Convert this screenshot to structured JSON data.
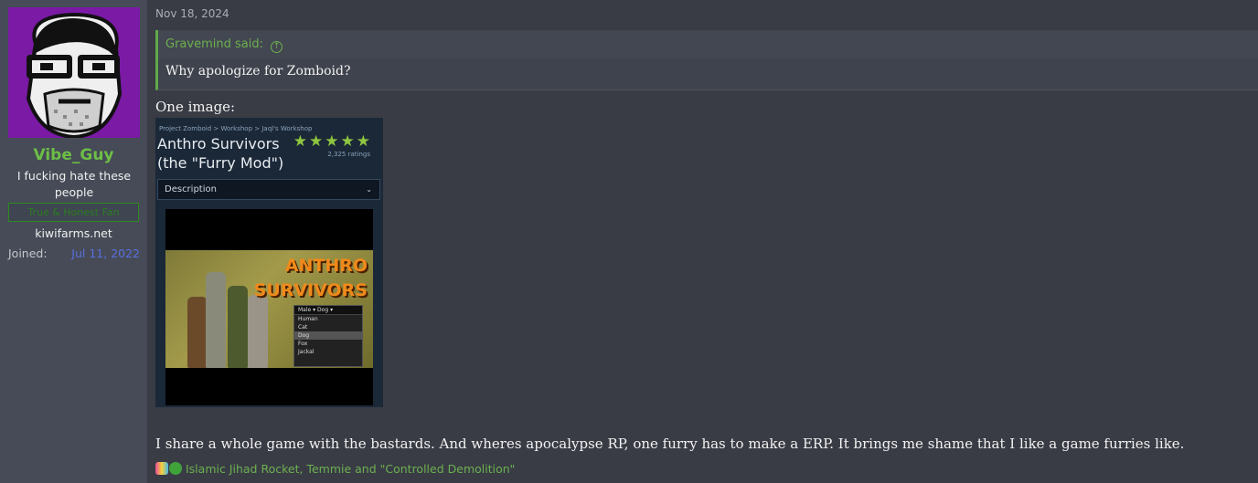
{
  "post": {
    "date": "Nov 18, 2024"
  },
  "author": {
    "username": "Vibe_Guy",
    "title": "I fucking hate these people",
    "banner": "True & Honest Fan",
    "site": "kiwifarms.net",
    "joined_label": "Joined:",
    "joined_value": "Jul 11, 2022"
  },
  "quote": {
    "author": "Gravemind said:",
    "text": "Why apologize for Zomboid?"
  },
  "body": {
    "line1": "One image:",
    "line2": "I share a whole game with the bastards. And wheres apocalypse RP, one furry has to make a ERP. It brings me shame that I like a game furries like."
  },
  "embed": {
    "breadcrumb": "Project Zomboid  >  Workshop  >  Jaql's Workshop",
    "title": "Anthro Survivors (the \"Furry Mod\")",
    "stars": "★★★★★",
    "ratings": "2,325 ratings",
    "description_label": "Description",
    "game_title_1": "ANTHRO",
    "game_title_2": "SURVIVORS",
    "dropdown": {
      "gender": "Male",
      "species": "Dog",
      "options": [
        "Human",
        "Cat",
        "Dog",
        "Fox",
        "Jackal"
      ]
    }
  },
  "reactions": {
    "text": "Islamic Jihad Rocket, Temmie and \"Controlled Demolition\""
  },
  "colors": {
    "accent": "#6cb04f",
    "username": "#6cbf46",
    "joined": "#5a6fe0",
    "background": "#393c45"
  }
}
